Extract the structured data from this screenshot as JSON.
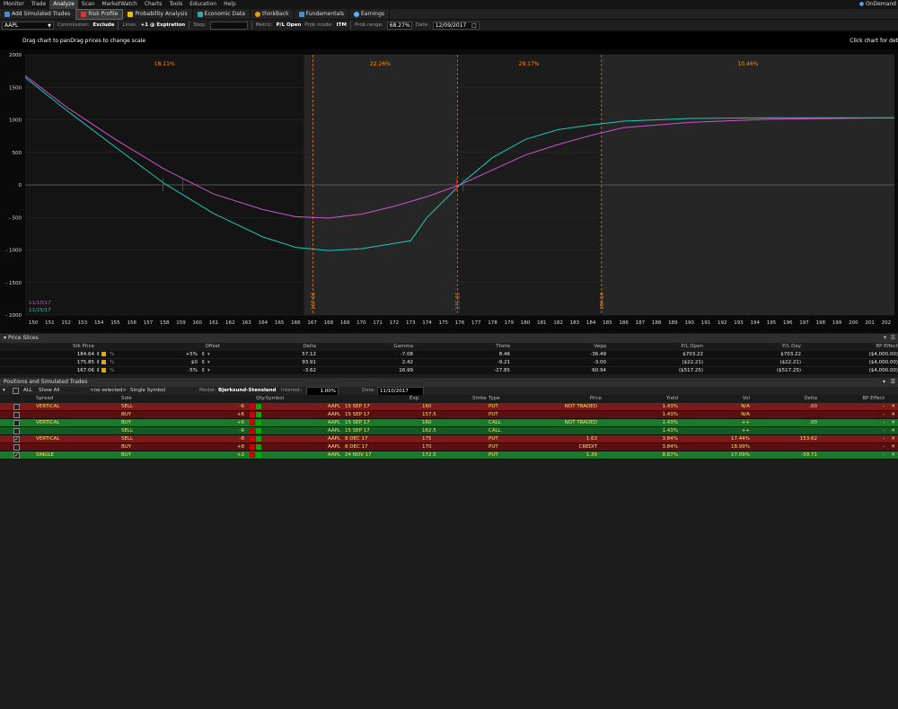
{
  "menubar": {
    "items": [
      "Monitor",
      "Trade",
      "Analyze",
      "Scan",
      "MarketWatch",
      "Charts",
      "Tools",
      "Education",
      "Help"
    ],
    "active": "Analyze",
    "ondemand": "OnDemand"
  },
  "toolbar1": {
    "items": [
      "Add Simulated Trades",
      "Risk Profile",
      "Probability Analysis",
      "Economic Data",
      "thinkBack",
      "Fundamentals",
      "Earnings"
    ]
  },
  "toolbar2": {
    "symbol": "AAPL",
    "commission_label": "Commission:",
    "commission_value": "Exclude",
    "lines_label": "Lines:",
    "lines_value": "+1 @ Expiration",
    "step_label": "Step:",
    "metric_label": "Metric:",
    "metric_value": "P/L Open",
    "probmode_label": "Prob mode:",
    "probmode_value": "ITM",
    "probrange_label": "Prob range:",
    "probrange_value": "68.27%",
    "date_label": "Date:",
    "date_value": "12/09/2017"
  },
  "hint": {
    "left": "Drag chart to panDrag prices to change scale",
    "right": "Click chart for det"
  },
  "chart_data": {
    "type": "line",
    "x_ticks": [
      150,
      151,
      152,
      153,
      154,
      155,
      156,
      157,
      158,
      159,
      160,
      161,
      162,
      163,
      164,
      165,
      166,
      167,
      168,
      169,
      170,
      171,
      172,
      173,
      174,
      175,
      176,
      177,
      178,
      179,
      180,
      181,
      182,
      183,
      184,
      185,
      186,
      187,
      188,
      189,
      190,
      191,
      192,
      193,
      194,
      195,
      196,
      197,
      198,
      199,
      200,
      201,
      202
    ],
    "x_tick_labels": [
      "150",
      "151",
      "152",
      "153",
      "154",
      "155",
      "156",
      "157",
      "158",
      "159",
      "160",
      "161",
      "162",
      "163",
      "164",
      "165",
      "166",
      "167",
      "168",
      "169",
      "170",
      "171",
      "172",
      "173",
      "174",
      "175",
      "176",
      "177",
      "178",
      "179",
      "180",
      "181",
      "182",
      "183",
      "184",
      "185",
      "186",
      "187",
      "188",
      "189",
      "190",
      "191",
      "192",
      "193",
      "194",
      "195",
      "196",
      "197",
      "198",
      "199",
      "200",
      "201",
      "202"
    ],
    "y_ticks": [
      2000,
      1500,
      1000,
      500,
      0,
      -500,
      -1000,
      -1500,
      -2000
    ],
    "y_tick_labels": [
      "2000",
      "1500",
      "1000",
      "500",
      "0",
      "- 500",
      "- 1000",
      "- 1500",
      "- 2000"
    ],
    "xlim": [
      149.5,
      202.5
    ],
    "ylim": [
      -2000,
      2000
    ],
    "zones": [
      {
        "from": 149.5,
        "to": 166.5,
        "label": "18.11%"
      },
      {
        "from": 166.5,
        "to": 175.8,
        "label": "22.26%"
      },
      {
        "from": 175.8,
        "to": 184.64,
        "label": "29.17%"
      },
      {
        "from": 184.64,
        "to": 202.5,
        "label": "10.46%"
      }
    ],
    "vlines": [
      {
        "x": 167.06,
        "label": "167.06"
      },
      {
        "x": 175.85,
        "label": "175.85"
      },
      {
        "x": 184.64,
        "label": "184.64"
      }
    ],
    "series": [
      {
        "name": "11/10/17",
        "color": "#cc55cc",
        "x": [
          149.5,
          152,
          155,
          158,
          161,
          164,
          166,
          168,
          170,
          172,
          174,
          176,
          178,
          180,
          182,
          184,
          186,
          190,
          195,
          202.5
        ],
        "y": [
          1680,
          1200,
          700,
          240,
          -140,
          -380,
          -490,
          -510,
          -450,
          -330,
          -180,
          0,
          230,
          460,
          620,
          760,
          880,
          960,
          1010,
          1030
        ]
      },
      {
        "name": "11/25/17",
        "color": "#1fc8b8",
        "x": [
          149.5,
          152,
          155,
          158,
          161,
          164,
          166,
          168,
          170,
          172,
          173,
          174,
          176,
          178,
          180,
          182,
          184,
          186,
          190,
          195,
          202.5
        ],
        "y": [
          1650,
          1150,
          580,
          20,
          -440,
          -800,
          -960,
          -1010,
          -980,
          -900,
          -860,
          -500,
          0,
          420,
          700,
          850,
          920,
          980,
          1020,
          1030,
          1030
        ]
      }
    ],
    "legend": [
      {
        "label": "11/10/17",
        "color": "#cc55cc"
      },
      {
        "label": "11/25/17",
        "color": "#1fc8b8"
      }
    ],
    "markers": [
      {
        "x": 157.9
      },
      {
        "x": 159.1
      },
      {
        "x": 175.8
      },
      {
        "x": 176.2
      }
    ]
  },
  "price_slices": {
    "title": "Price Slices",
    "columns": [
      "Stk Price",
      "Offset",
      "Delta",
      "Gamma",
      "Theta",
      "Vega",
      "P/L Open",
      "P/L Day",
      "BP Effect"
    ],
    "rows": [
      {
        "stk": "184.64",
        "offset": "+5%",
        "delta": "57.12",
        "gamma": "-7.08",
        "theta": "8.46",
        "vega": "-36.49",
        "plopen": "$703.22",
        "plday": "$703.22",
        "bp": "($4,000.00)"
      },
      {
        "stk": "175.85",
        "offset": "$0",
        "delta": "93.91",
        "gamma": "2.42",
        "theta": "-9.21",
        "vega": "-3.00",
        "plopen": "($22.21)",
        "plday": "($22.21)",
        "bp": "($4,000.00)"
      },
      {
        "stk": "167.06",
        "offset": "-5%",
        "delta": "-3.62",
        "gamma": "16.99",
        "theta": "-27.85",
        "vega": "60.94",
        "plopen": "($517.25)",
        "plday": "($517.25)",
        "bp": "($4,000.00)"
      }
    ]
  },
  "positions": {
    "title": "Positions and Simulated Trades",
    "filter_all": "ALL",
    "show": "Show All",
    "selected": "<no selected>",
    "mode": "Single Symbol",
    "model_label": "Model:",
    "model_value": "Bjerksund-Stensland",
    "interest_label": "Interest:",
    "interest_value": "1.00%",
    "date_label": "Date:",
    "date_value": "11/10/2017",
    "columns": [
      "Spread",
      "Side",
      "Qty.Symbol",
      "Exp",
      "Strike",
      "Type",
      "Price",
      "Yield",
      "Vol",
      "Delta",
      "BP Effect"
    ],
    "rows": [
      {
        "spread": "VERTICAL",
        "side": "SELL",
        "qty": "-6",
        "sym": "AAPL",
        "exp": "15 SEP 17",
        "strike": "160",
        "type": "PUT",
        "price": "NOT TRADED",
        "yield": "1.43%",
        "vol": "N/A",
        "delta": ".00",
        "bp": "-",
        "color": "red",
        "checked": false
      },
      {
        "spread": "",
        "side": "BUY",
        "qty": "+6",
        "sym": "AAPL",
        "exp": "15 SEP 17",
        "strike": "157.5",
        "type": "PUT",
        "price": "",
        "yield": "1.43%",
        "vol": "N/A",
        "delta": "",
        "bp": "-",
        "color": "darkred",
        "checked": false
      },
      {
        "spread": "VERTICAL",
        "side": "BUY",
        "qty": "+6",
        "sym": "AAPL",
        "exp": "15 SEP 17",
        "strike": "160",
        "type": "CALL",
        "price": "NOT TRADED",
        "yield": "1.43%",
        "vol": "++",
        "delta": ".00",
        "bp": "-",
        "color": "green",
        "checked": false
      },
      {
        "spread": "",
        "side": "SELL",
        "qty": "-6",
        "sym": "AAPL",
        "exp": "15 SEP 17",
        "strike": "162.5",
        "type": "CALL",
        "price": "",
        "yield": "1.43%",
        "vol": "++",
        "delta": "",
        "bp": "-",
        "color": "darkgreen",
        "checked": false
      },
      {
        "spread": "VERTICAL",
        "side": "SELL",
        "qty": "-8",
        "sym": "AAPL",
        "exp": "8 DEC 17",
        "strike": "175",
        "type": "PUT",
        "price": "1.63",
        "yield": "3.84%",
        "vol": "17.44%",
        "delta": "153.62",
        "bp": "-",
        "color": "red",
        "checked": true
      },
      {
        "spread": "",
        "side": "BUY",
        "qty": "+8",
        "sym": "AAPL",
        "exp": "8 DEC 17",
        "strike": "170",
        "type": "PUT",
        "price": "CREDIT",
        "yield": "3.84%",
        "vol": "18.99%",
        "delta": "",
        "bp": "-",
        "color": "darkred",
        "checked": false
      },
      {
        "spread": "SINGLE",
        "side": "BUY",
        "qty": "+2",
        "sym": "AAPL",
        "exp": "24 NOV 17",
        "strike": "172.5",
        "type": "PUT",
        "price": "1.39",
        "yield": "8.87%",
        "vol": "17.09%",
        "delta": "-59.71",
        "bp": "-",
        "color": "green",
        "checked": true
      }
    ]
  },
  "colors": {
    "accent": "#ff8c1a",
    "purple_series": "#cc55cc",
    "teal_series": "#1fc8b8"
  }
}
